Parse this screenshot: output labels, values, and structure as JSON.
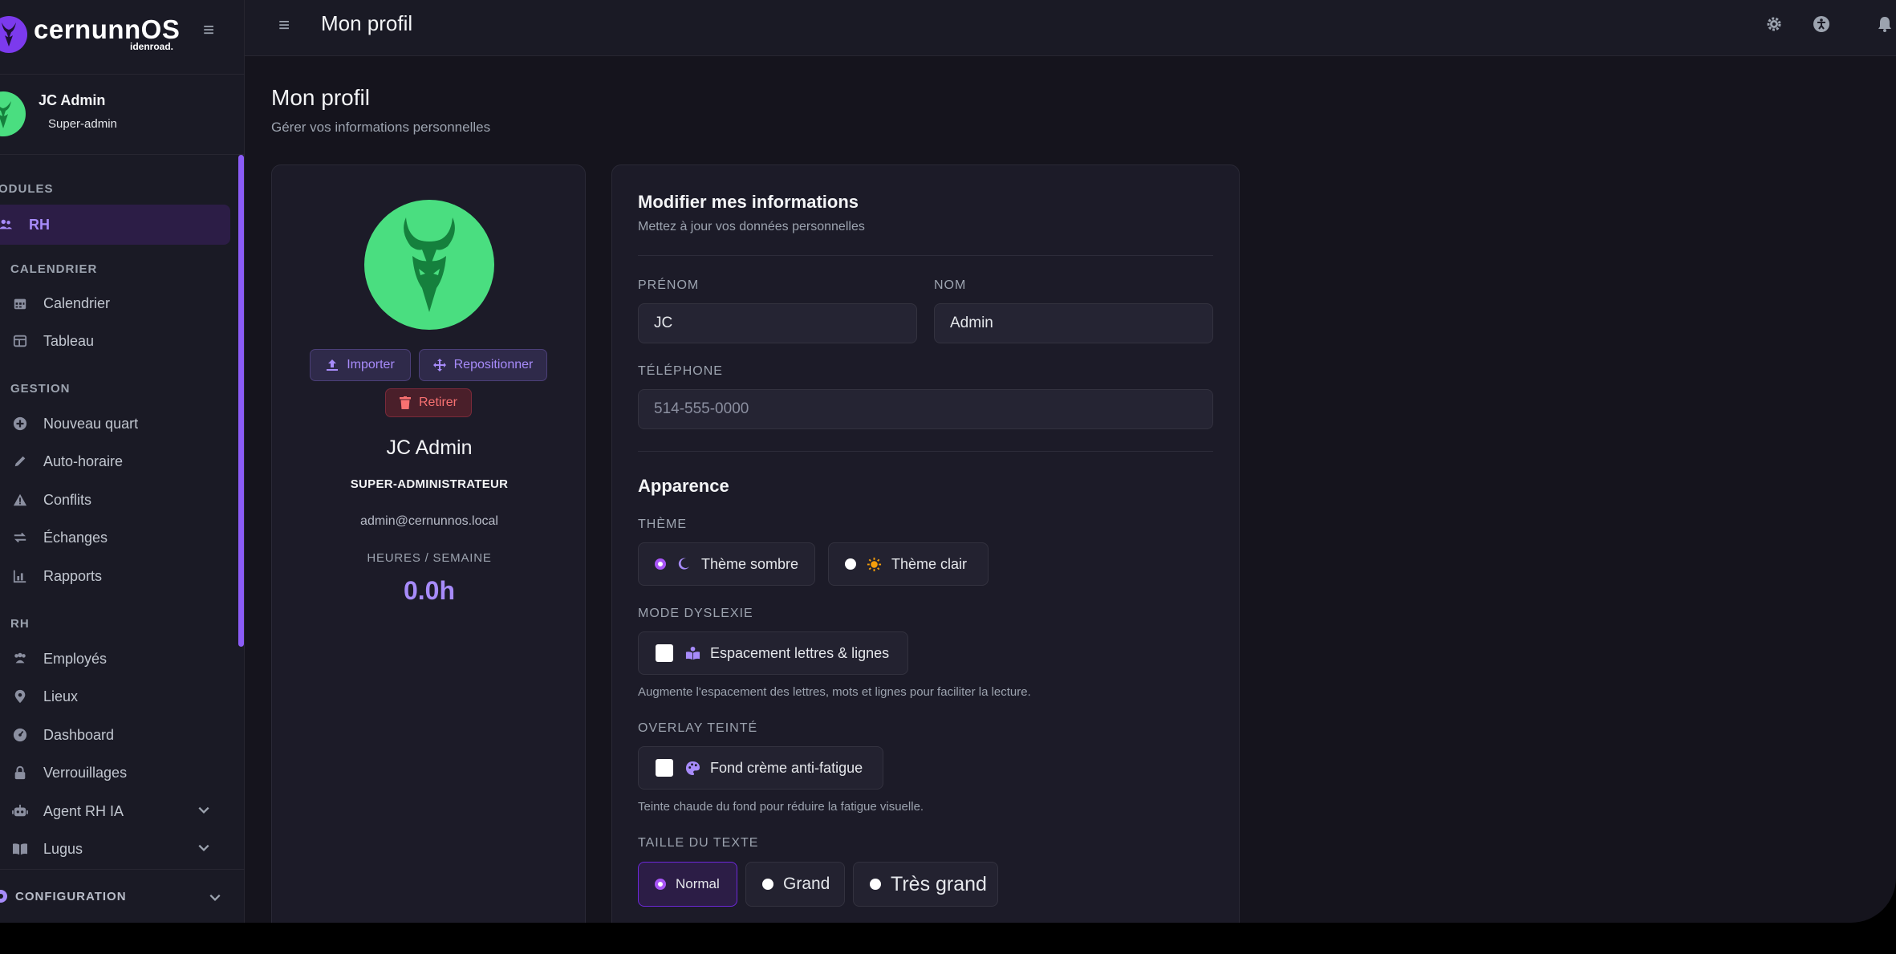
{
  "brand": {
    "name": "cernunnOS",
    "sub": "idenroad."
  },
  "user": {
    "name": "JC Admin",
    "role": "Super-admin"
  },
  "sidebar": {
    "sections": {
      "modules": "ODULES",
      "calendrier": "CALENDRIER",
      "gestion": "GESTION",
      "rh": "RH"
    },
    "items": {
      "rh": "RH",
      "calendrier": "Calendrier",
      "tableau": "Tableau",
      "nouveau_quart": "Nouveau quart",
      "auto_horaire": "Auto-horaire",
      "conflits": "Conflits",
      "echanges": "Échanges",
      "rapports": "Rapports",
      "employes": "Employés",
      "lieux": "Lieux",
      "dashboard": "Dashboard",
      "verrouillages": "Verrouillages",
      "agent_rh_ia": "Agent RH IA",
      "lugus": "Lugus"
    },
    "config": "CONFIGURATION"
  },
  "topbar": {
    "title": "Mon profil"
  },
  "page": {
    "title": "Mon profil",
    "subtitle": "Gérer vos informations personnelles"
  },
  "profile": {
    "import": "Importer",
    "reposition": "Repositionner",
    "remove": "Retirer",
    "name": "JC Admin",
    "role": "SUPER-ADMINISTRATEUR",
    "email": "admin@cernunnos.local",
    "hours_label": "HEURES / SEMAINE",
    "hours": "0.0h"
  },
  "form": {
    "title": "Modifier mes informations",
    "subtitle": "Mettez à jour vos données personnelles",
    "prenom_label": "PRÉNOM",
    "prenom_value": "JC",
    "nom_label": "NOM",
    "nom_value": "Admin",
    "tel_label": "TÉLÉPHONE",
    "tel_placeholder": "514-555-0000"
  },
  "appearance": {
    "title": "Apparence",
    "theme_label": "THÈME",
    "theme_dark": "Thème sombre",
    "theme_light": "Thème clair",
    "theme_selected": "dark",
    "dyslexia_label": "MODE DYSLEXIE",
    "dyslexia_option": "Espacement lettres & lignes",
    "dyslexia_checked": false,
    "dyslexia_hint": "Augmente l'espacement des lettres, mots et lignes pour faciliter la lecture.",
    "overlay_label": "OVERLAY TEINTÉ",
    "overlay_option": "Fond crème anti-fatigue",
    "overlay_checked": false,
    "overlay_hint": "Teinte chaude du fond pour réduire la fatigue visuelle.",
    "text_size_label": "TAILLE DU TEXTE",
    "size_normal": "Normal",
    "size_grand": "Grand",
    "size_tres_grand": "Très grand",
    "size_selected": "normal"
  },
  "colors": {
    "accent": "#a78bfa",
    "active_bg": "#2c1d46",
    "avatar_green": "#4ade80",
    "danger": "#f87171"
  }
}
